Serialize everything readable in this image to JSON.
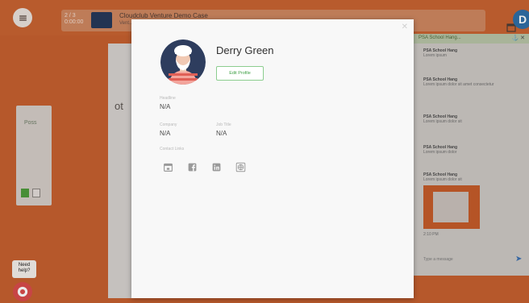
{
  "app": {
    "page_counter": "2 / 3",
    "page_counter_sub": "0:00:00",
    "presentation_title": "Cloudclub Venture Demo Case",
    "presentation_subtitle": "Vent...",
    "user_initial": "D"
  },
  "stage": {
    "partial_text": "ot"
  },
  "left_panel": {
    "label": "Poss"
  },
  "chat": {
    "title": "PSA School Hang...",
    "messages": [
      {
        "author": "PSA School Hang",
        "text": "Lorem ipsum"
      },
      {
        "author": "PSA School Hang",
        "text": "Lorem ipsum dolor sit amet consectetur"
      },
      {
        "author": "PSA School Hang",
        "text": "Lorem ipsum dolor sit"
      },
      {
        "author": "PSA School Hang",
        "text": "Lorem ipsum dolor"
      },
      {
        "author": "PSA School Hang",
        "text": "Lorem ipsum dolor sit"
      }
    ],
    "image_caption": "2:10 PM",
    "input_placeholder": "Type a message"
  },
  "help": {
    "label": "Need help?"
  },
  "profile": {
    "name": "Derry Green",
    "edit_button": "Edit Profile",
    "fields": {
      "headline_label": "Headline",
      "headline_value": "N/A",
      "company_label": "Company",
      "company_value": "N/A",
      "job_title_label": "Job Title",
      "job_title_value": "N/A",
      "contact_links_label": "Contact Links"
    },
    "contact_icons": [
      "calendar-icon",
      "facebook-icon",
      "linkedin-icon",
      "globe-icon"
    ]
  },
  "colors": {
    "background_orange": "#c6602f",
    "accent_green": "#3e9f44",
    "avatar_navy": "#2e3d5e",
    "avatar_shirt_red": "#e05f56",
    "user_avatar_blue": "#2f6ea6"
  }
}
